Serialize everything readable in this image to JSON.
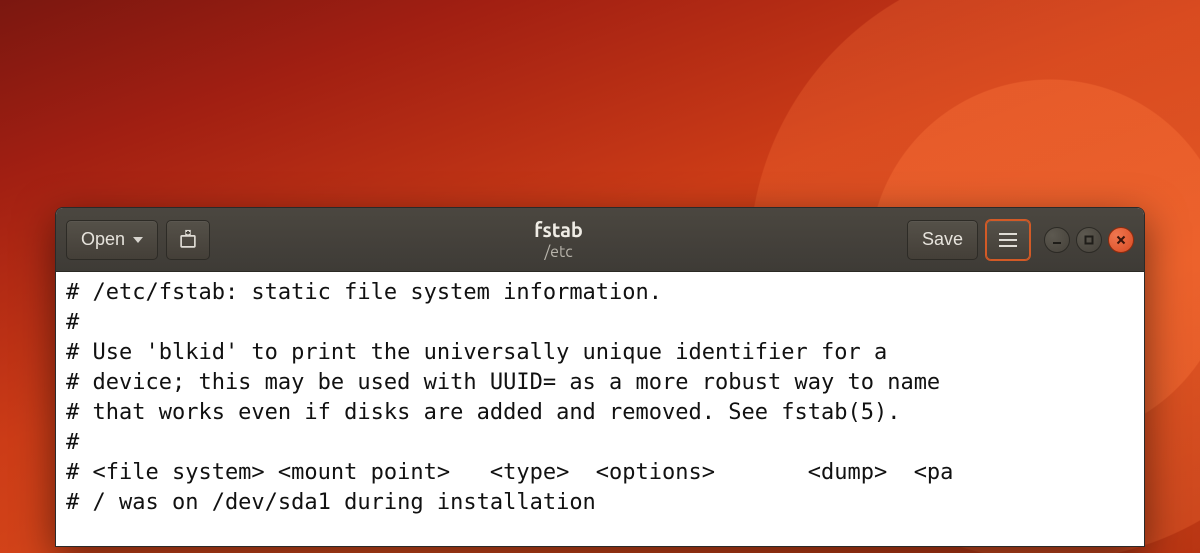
{
  "header": {
    "open_label": "Open",
    "save_label": "Save",
    "title": "fstab",
    "subtitle": "/etc"
  },
  "file": {
    "lines": [
      "# /etc/fstab: static file system information.",
      "#",
      "# Use 'blkid' to print the universally unique identifier for a",
      "# device; this may be used with UUID= as a more robust way to name",
      "# that works even if disks are added and removed. See fstab(5).",
      "#",
      "# <file system> <mount point>   <type>  <options>       <dump>  <pa",
      "# / was on /dev/sda1 during installation"
    ]
  }
}
